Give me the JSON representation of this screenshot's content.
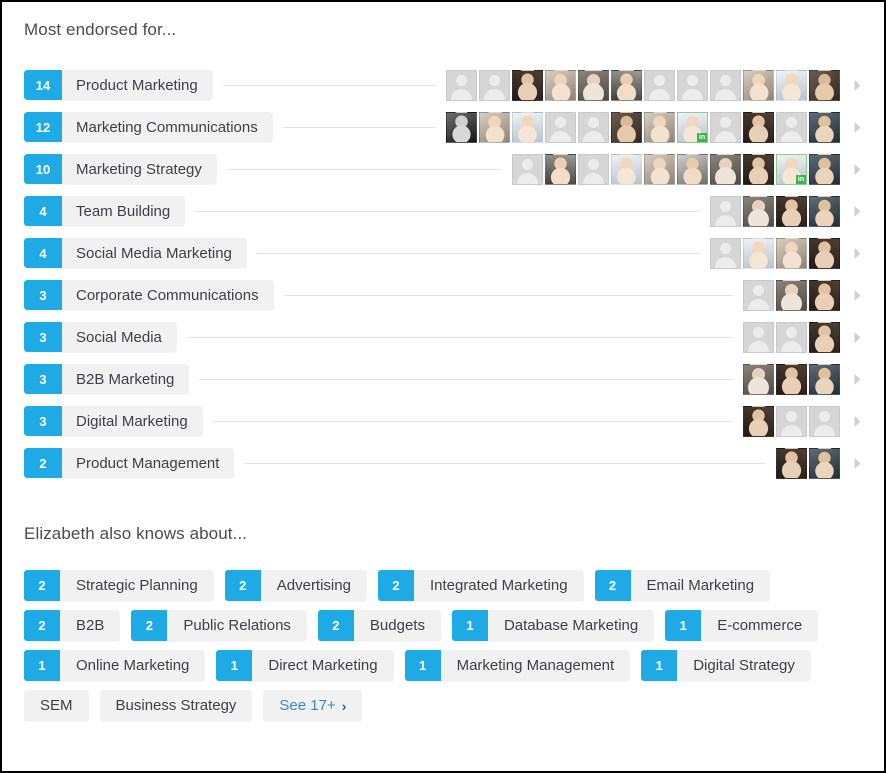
{
  "sections": {
    "endorsed_heading": "Most endorsed for...",
    "also_knows_heading": "Elizabeth also knows about..."
  },
  "colors": {
    "badge_blue": "#1eaae4",
    "pill_gray": "#f1f1f1",
    "link_blue": "#3a86c8",
    "connector_gray": "#e4e4e4",
    "border_black": "#000000",
    "in_badge_green": "#3fb34f"
  },
  "endorsements": [
    {
      "count": "14",
      "skill": "Product Marketing",
      "avatars": [
        "ph",
        "ph",
        "ph2",
        "ph1",
        "ph0",
        "ph5",
        "ph",
        "ph",
        "ph",
        "ph1",
        "ph3",
        "ph4"
      ],
      "in_badges": []
    },
    {
      "count": "12",
      "skill": "Marketing Communications",
      "avatars": [
        "bw",
        "ph1",
        "ph3",
        "ph",
        "ph",
        "ph4",
        "ph1",
        "ph3",
        "ph",
        "ph2",
        "ph",
        "ph6"
      ],
      "in_badges": [
        7
      ]
    },
    {
      "count": "10",
      "skill": "Marketing Strategy",
      "avatars": [
        "ph",
        "ph5",
        "ph",
        "ph3",
        "ph1",
        "ph7",
        "ph0",
        "ph2",
        "ph3",
        "ph6"
      ],
      "in_badges": [
        8
      ]
    },
    {
      "count": "4",
      "skill": "Team Building",
      "avatars": [
        "ph",
        "ph0",
        "ph2",
        "ph6"
      ],
      "in_badges": []
    },
    {
      "count": "4",
      "skill": "Social Media Marketing",
      "avatars": [
        "ph",
        "ph3",
        "ph1",
        "ph2"
      ],
      "in_badges": []
    },
    {
      "count": "3",
      "skill": "Corporate Communications",
      "avatars": [
        "ph",
        "ph0",
        "ph2"
      ],
      "in_badges": []
    },
    {
      "count": "3",
      "skill": "Social Media",
      "avatars": [
        "ph",
        "ph",
        "ph2"
      ],
      "in_badges": []
    },
    {
      "count": "3",
      "skill": "B2B Marketing",
      "avatars": [
        "ph0",
        "ph2",
        "ph6"
      ],
      "in_badges": []
    },
    {
      "count": "3",
      "skill": "Digital Marketing",
      "avatars": [
        "ph2",
        "ph",
        "ph"
      ],
      "in_badges": []
    },
    {
      "count": "2",
      "skill": "Product Management",
      "avatars": [
        "ph2",
        "ph6"
      ],
      "in_badges": []
    }
  ],
  "also_knows_tags": [
    {
      "count": "2",
      "label": "Strategic Planning"
    },
    {
      "count": "2",
      "label": "Advertising"
    },
    {
      "count": "2",
      "label": "Integrated Marketing"
    },
    {
      "count": "2",
      "label": "Email Marketing"
    },
    {
      "count": "2",
      "label": "B2B"
    },
    {
      "count": "2",
      "label": "Public Relations"
    },
    {
      "count": "2",
      "label": "Budgets"
    },
    {
      "count": "1",
      "label": "Database Marketing"
    },
    {
      "count": "1",
      "label": "E-commerce"
    },
    {
      "count": "1",
      "label": "Online Marketing"
    },
    {
      "count": "1",
      "label": "Direct Marketing"
    },
    {
      "count": "1",
      "label": "Marketing Management"
    },
    {
      "count": "1",
      "label": "Digital Strategy"
    },
    {
      "count": "",
      "label": "SEM"
    },
    {
      "count": "",
      "label": "Business Strategy"
    }
  ],
  "see_more": {
    "label": "See 17+",
    "chevron": "›"
  },
  "icons": {
    "row_chevron": "chevron-right-icon",
    "see_more_chevron": "chevron-right-icon",
    "avatar_placeholder": "person-placeholder-icon",
    "linkedin_badge": "linkedin-in-badge-icon"
  }
}
